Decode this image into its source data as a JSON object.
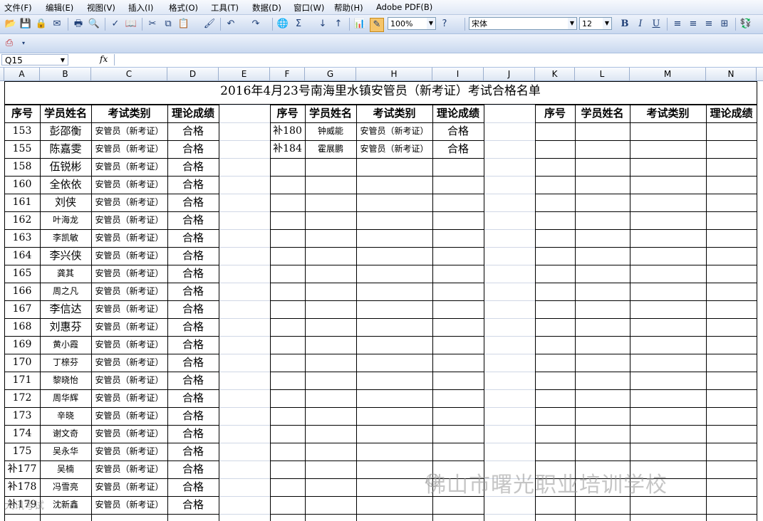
{
  "menu": [
    "文件(F)",
    "编辑(E)",
    "视图(V)",
    "插入(I)",
    "格式(O)",
    "工具(T)",
    "数据(D)",
    "窗口(W)",
    "帮助(H)",
    "Adobe PDF(B)"
  ],
  "toolbar": {
    "zoom": "100%",
    "font": "宋体",
    "font_size": "12"
  },
  "formula_bar": {
    "name_box": "Q15",
    "fx": "fx",
    "formula": ""
  },
  "columns": [
    "A",
    "B",
    "C",
    "D",
    "E",
    "F",
    "G",
    "H",
    "I",
    "J",
    "K",
    "L",
    "M",
    "N"
  ],
  "sheet": {
    "title": "2016年4月23号南海里水镇安管员（新考证）考试合格名单",
    "headers": [
      "序号",
      "学员姓名",
      "考试类别",
      "理论成绩"
    ],
    "left_rows": [
      {
        "no": "153",
        "name": "彭邵衡",
        "cat": "安管员（新考证）",
        "res": "合格"
      },
      {
        "no": "155",
        "name": "陈嘉雯",
        "cat": "安管员（新考证）",
        "res": "合格"
      },
      {
        "no": "158",
        "name": "伍锐彬",
        "cat": "安管员（新考证）",
        "res": "合格"
      },
      {
        "no": "160",
        "name": "全依依",
        "cat": "安管员（新考证）",
        "res": "合格"
      },
      {
        "no": "161",
        "name": "刘侠",
        "cat": "安管员（新考证）",
        "res": "合格"
      },
      {
        "no": "162",
        "name": "叶海龙",
        "cat": "安管员（新考证）",
        "res": "合格"
      },
      {
        "no": "163",
        "name": "李凯敏",
        "cat": "安管员（新考证）",
        "res": "合格"
      },
      {
        "no": "164",
        "name": "李兴侠",
        "cat": "安管员（新考证）",
        "res": "合格"
      },
      {
        "no": "165",
        "name": "龚其",
        "cat": "安管员（新考证）",
        "res": "合格"
      },
      {
        "no": "166",
        "name": "周之凡",
        "cat": "安管员（新考证）",
        "res": "合格"
      },
      {
        "no": "167",
        "name": "李信达",
        "cat": "安管员（新考证）",
        "res": "合格"
      },
      {
        "no": "168",
        "name": "刘惠芬",
        "cat": "安管员（新考证）",
        "res": "合格"
      },
      {
        "no": "169",
        "name": "黄小霞",
        "cat": "安管员（新考证）",
        "res": "合格"
      },
      {
        "no": "170",
        "name": "丁榇芬",
        "cat": "安管员（新考证）",
        "res": "合格"
      },
      {
        "no": "171",
        "name": "黎晓怡",
        "cat": "安管员（新考证）",
        "res": "合格"
      },
      {
        "no": "172",
        "name": "周华辉",
        "cat": "安管员（新考证）",
        "res": "合格"
      },
      {
        "no": "173",
        "name": "辛晓",
        "cat": "安管员（新考证）",
        "res": "合格"
      },
      {
        "no": "174",
        "name": "谢文奇",
        "cat": "安管员（新考证）",
        "res": "合格"
      },
      {
        "no": "175",
        "name": "吴永华",
        "cat": "安管员（新考证）",
        "res": "合格"
      },
      {
        "no": "补177",
        "name": "吴楠",
        "cat": "安管员（新考证）",
        "res": "合格"
      },
      {
        "no": "补178",
        "name": "冯雪亮",
        "cat": "安管员（新考证）",
        "res": "合格"
      },
      {
        "no": "补179",
        "name": "沈新鑫",
        "cat": "安管员（新考证）",
        "res": "合格"
      }
    ],
    "mid_rows": [
      {
        "no": "补180",
        "name": "钟威能",
        "cat": "安管员（新考证）",
        "res": "合格"
      },
      {
        "no": "补184",
        "name": "霍展鹏",
        "cat": "安管员（新考证）",
        "res": "合格"
      }
    ]
  },
  "watermark": {
    "text": "佛山市曙光职业培训学校",
    "corner": "大讯考试"
  }
}
